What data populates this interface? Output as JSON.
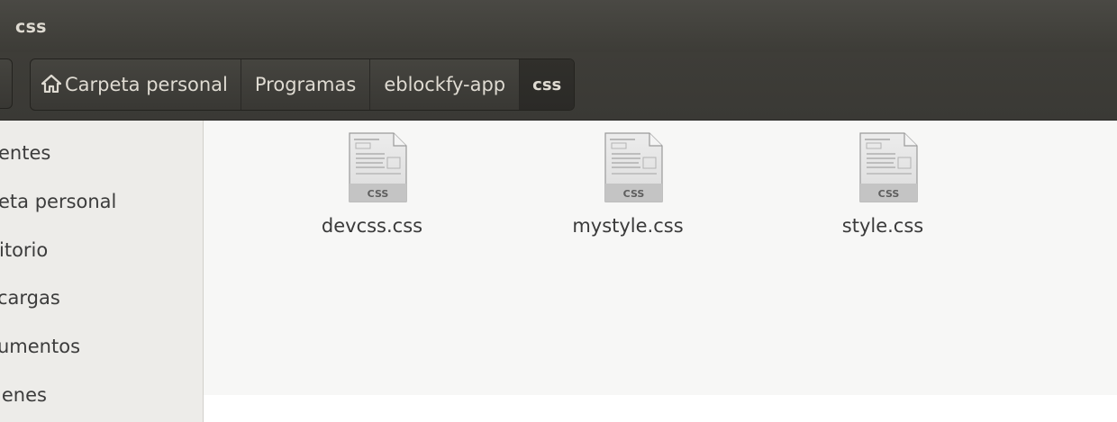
{
  "window": {
    "title": "css"
  },
  "breadcrumb": {
    "items": [
      {
        "label": "Carpeta personal",
        "icon": "home-icon"
      },
      {
        "label": "Programas"
      },
      {
        "label": "eblockfy-app"
      },
      {
        "label": "css",
        "active": true
      }
    ]
  },
  "sidebar": {
    "items": [
      {
        "label": "entes"
      },
      {
        "label": "eta personal"
      },
      {
        "label": "itorio"
      },
      {
        "label": "cargas"
      },
      {
        "label": "umentos"
      },
      {
        "label": "jenes"
      }
    ]
  },
  "files": [
    {
      "name": "devcss.css",
      "badge": "CSS",
      "icon": "css-file-icon"
    },
    {
      "name": "mystyle.css",
      "badge": "CSS",
      "icon": "css-file-icon"
    },
    {
      "name": "style.css",
      "badge": "CSS",
      "icon": "css-file-icon"
    }
  ],
  "colors": {
    "titlebar": "#3d3c37",
    "title_text": "#dfdbd2",
    "sidebar_bg": "#edece9",
    "content_bg": "#f7f7f6"
  }
}
